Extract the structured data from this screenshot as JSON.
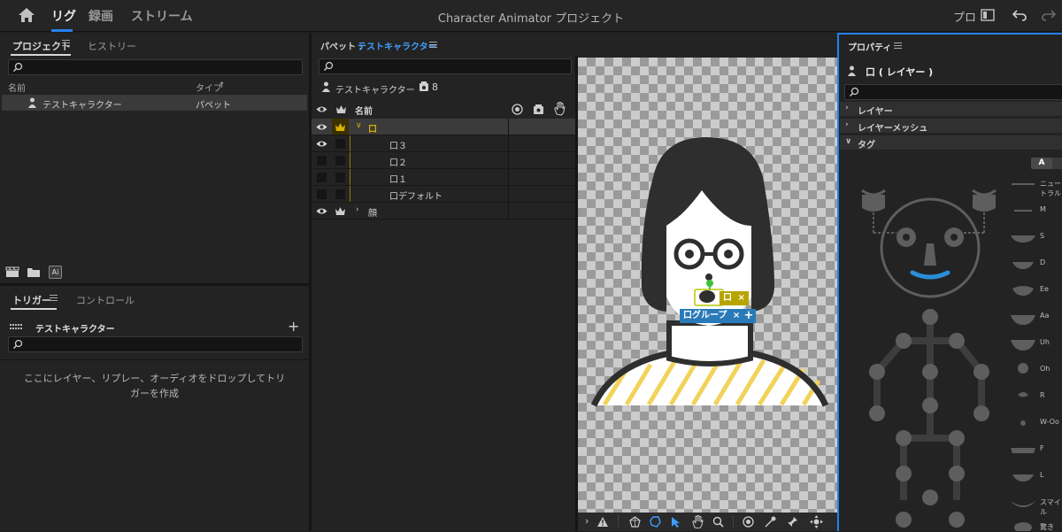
{
  "app": {
    "title": "Character Animator プロジェクト",
    "nav": [
      "リグ",
      "録画",
      "ストリーム"
    ],
    "right_label": "プロ"
  },
  "project_panel": {
    "tabs": [
      "プロジェクト",
      "ヒストリー"
    ],
    "columns": [
      "名前",
      "タイプ"
    ],
    "items": [
      {
        "name": "テストキャラクター",
        "type": "パペット"
      }
    ],
    "ai_badge": "Ai"
  },
  "trigger_panel": {
    "tabs": [
      "トリガー",
      "コントロール"
    ],
    "character": "テストキャラクター",
    "add": "+",
    "empty_message_line1": "ここにレイヤー、リプレー、オーディオをドロップしてトリ",
    "empty_message_line2": "ガーを作成"
  },
  "puppet_panel": {
    "label": "パペット :",
    "puppet_name": "テストキャラクター",
    "character": "テストキャラクター",
    "count": "8",
    "column": "名前",
    "layers": [
      {
        "name": "口",
        "level": 0,
        "expanded": true
      },
      {
        "name": "口３",
        "level": 1
      },
      {
        "name": "口２",
        "level": 1
      },
      {
        "name": "口１",
        "level": 1
      },
      {
        "name": "口デフォルト",
        "level": 1
      },
      {
        "name": "顔",
        "level": 0,
        "expanded": false
      }
    ]
  },
  "canvas": {
    "tag_label": "口",
    "group_label": "口グループ",
    "group_close": "×",
    "tag_close": "×",
    "add": "+"
  },
  "properties": {
    "title": "プロパティ",
    "layer_name": "口 ( レイヤー )",
    "sections": [
      "レイヤー",
      "レイヤーメッシュ",
      "タグ"
    ],
    "tag_button": "A",
    "mouth_tags": [
      "ニュートラル",
      "M",
      "S",
      "D",
      "Ee",
      "Aa",
      "Uh",
      "Oh",
      "R",
      "W-Oo",
      "F",
      "L",
      "スマイル",
      "驚き"
    ]
  },
  "colors": {
    "accent": "#2680eb",
    "puppet_blue": "#3ea0ff",
    "crown_yellow": "#d8b000",
    "tag_olive": "#b8a400",
    "group_blue": "#2a7ab8"
  }
}
